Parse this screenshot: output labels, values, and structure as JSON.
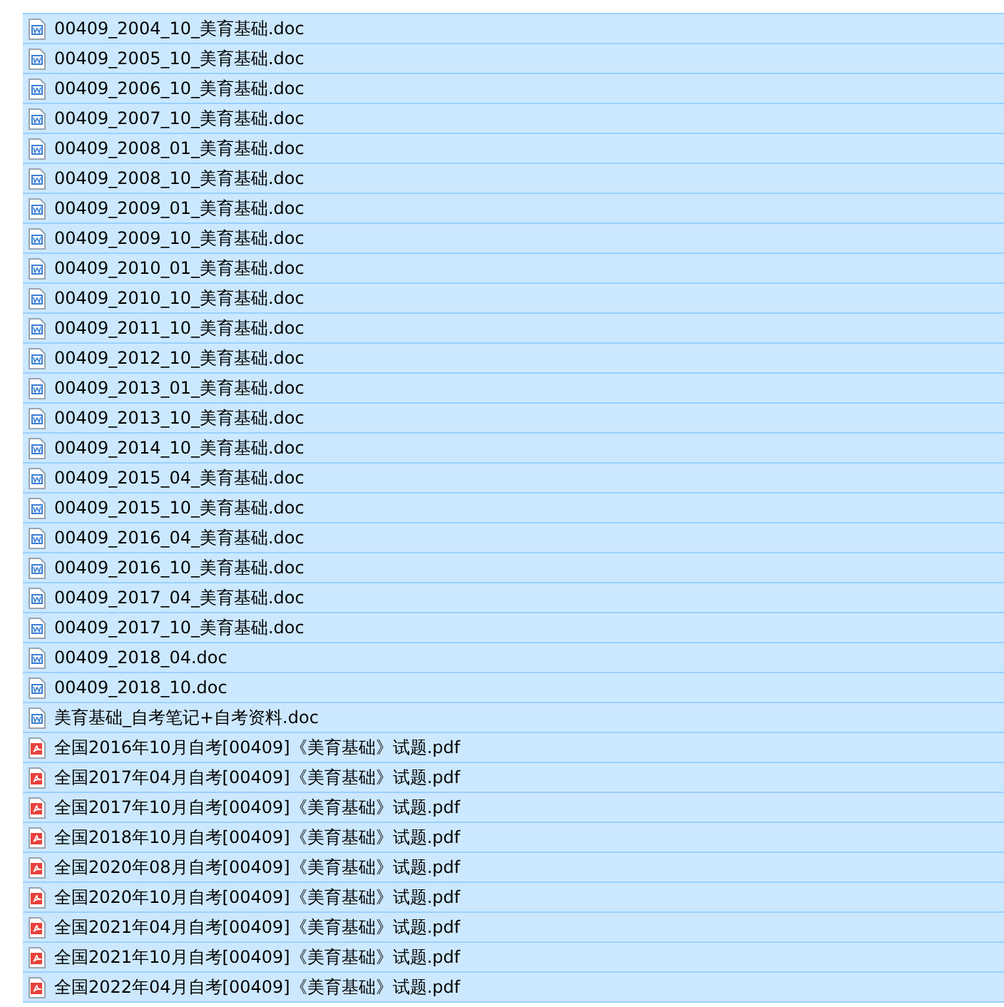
{
  "files": [
    {
      "name": "00409_2004_10_美育基础.doc",
      "kind": "doc",
      "selected": true
    },
    {
      "name": "00409_2005_10_美育基础.doc",
      "kind": "doc",
      "selected": true
    },
    {
      "name": "00409_2006_10_美育基础.doc",
      "kind": "doc",
      "selected": true
    },
    {
      "name": "00409_2007_10_美育基础.doc",
      "kind": "doc",
      "selected": true
    },
    {
      "name": "00409_2008_01_美育基础.doc",
      "kind": "doc",
      "selected": true
    },
    {
      "name": "00409_2008_10_美育基础.doc",
      "kind": "doc",
      "selected": true
    },
    {
      "name": "00409_2009_01_美育基础.doc",
      "kind": "doc",
      "selected": true
    },
    {
      "name": "00409_2009_10_美育基础.doc",
      "kind": "doc",
      "selected": true
    },
    {
      "name": "00409_2010_01_美育基础.doc",
      "kind": "doc",
      "selected": true
    },
    {
      "name": "00409_2010_10_美育基础.doc",
      "kind": "doc",
      "selected": true
    },
    {
      "name": "00409_2011_10_美育基础.doc",
      "kind": "doc",
      "selected": true
    },
    {
      "name": "00409_2012_10_美育基础.doc",
      "kind": "doc",
      "selected": true
    },
    {
      "name": "00409_2013_01_美育基础.doc",
      "kind": "doc",
      "selected": true
    },
    {
      "name": "00409_2013_10_美育基础.doc",
      "kind": "doc",
      "selected": true
    },
    {
      "name": "00409_2014_10_美育基础.doc",
      "kind": "doc",
      "selected": true
    },
    {
      "name": "00409_2015_04_美育基础.doc",
      "kind": "doc",
      "selected": true
    },
    {
      "name": "00409_2015_10_美育基础.doc",
      "kind": "doc",
      "selected": true
    },
    {
      "name": "00409_2016_04_美育基础.doc",
      "kind": "doc",
      "selected": true
    },
    {
      "name": "00409_2016_10_美育基础.doc",
      "kind": "doc",
      "selected": true
    },
    {
      "name": "00409_2017_04_美育基础.doc",
      "kind": "doc",
      "selected": true
    },
    {
      "name": "00409_2017_10_美育基础.doc",
      "kind": "doc",
      "selected": true
    },
    {
      "name": "00409_2018_04.doc",
      "kind": "doc",
      "selected": true
    },
    {
      "name": "00409_2018_10.doc",
      "kind": "doc",
      "selected": true
    },
    {
      "name": "美育基础_自考笔记+自考资料.doc",
      "kind": "doc",
      "selected": true
    },
    {
      "name": "全国2016年10月自考[00409]《美育基础》试题.pdf",
      "kind": "pdf",
      "selected": true
    },
    {
      "name": "全国2017年04月自考[00409]《美育基础》试题.pdf",
      "kind": "pdf",
      "selected": true
    },
    {
      "name": "全国2017年10月自考[00409]《美育基础》试题.pdf",
      "kind": "pdf",
      "selected": true
    },
    {
      "name": "全国2018年10月自考[00409]《美育基础》试题.pdf",
      "kind": "pdf",
      "selected": true
    },
    {
      "name": "全国2020年08月自考[00409]《美育基础》试题.pdf",
      "kind": "pdf",
      "selected": true
    },
    {
      "name": "全国2020年10月自考[00409]《美育基础》试题.pdf",
      "kind": "pdf",
      "selected": true
    },
    {
      "name": "全国2021年04月自考[00409]《美育基础》试题.pdf",
      "kind": "pdf",
      "selected": true
    },
    {
      "name": "全国2021年10月自考[00409]《美育基础》试题.pdf",
      "kind": "pdf",
      "selected": true
    },
    {
      "name": "全国2022年04月自考[00409]《美育基础》试题.pdf",
      "kind": "pdf",
      "selected": true
    }
  ]
}
